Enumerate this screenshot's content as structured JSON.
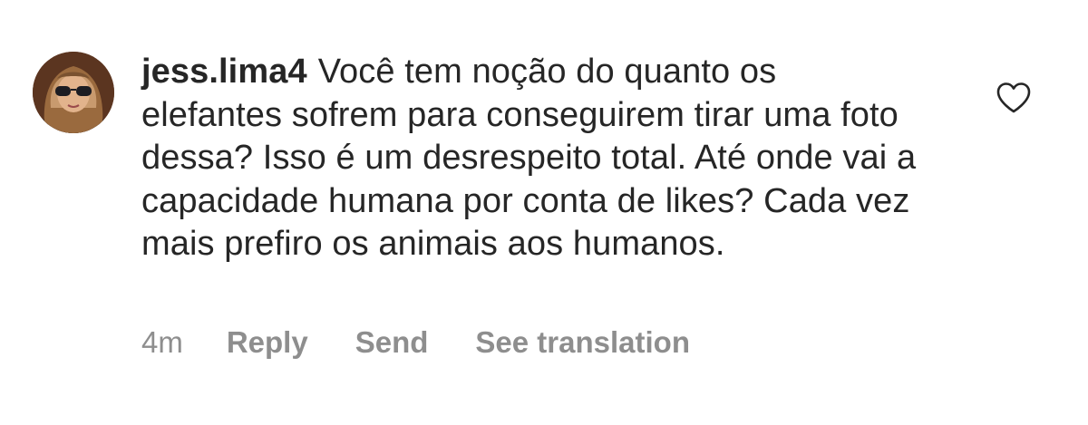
{
  "comment": {
    "username": "jess.lima4",
    "text": "Você tem noção do quanto os elefantes sofrem para conseguirem tirar uma foto dessa? Isso é um desrespeito total. Até onde vai a capacidade humana por conta de likes? Cada vez mais prefiro os animais aos humanos.",
    "timestamp": "4m",
    "actions": {
      "reply": "Reply",
      "send": "Send",
      "see_translation": "See translation"
    },
    "avatar_icon": "avatar-photo",
    "like_icon": "heart-outline-icon"
  },
  "colors": {
    "text": "#262626",
    "secondary_text": "#8e8e8e",
    "background": "#ffffff"
  }
}
